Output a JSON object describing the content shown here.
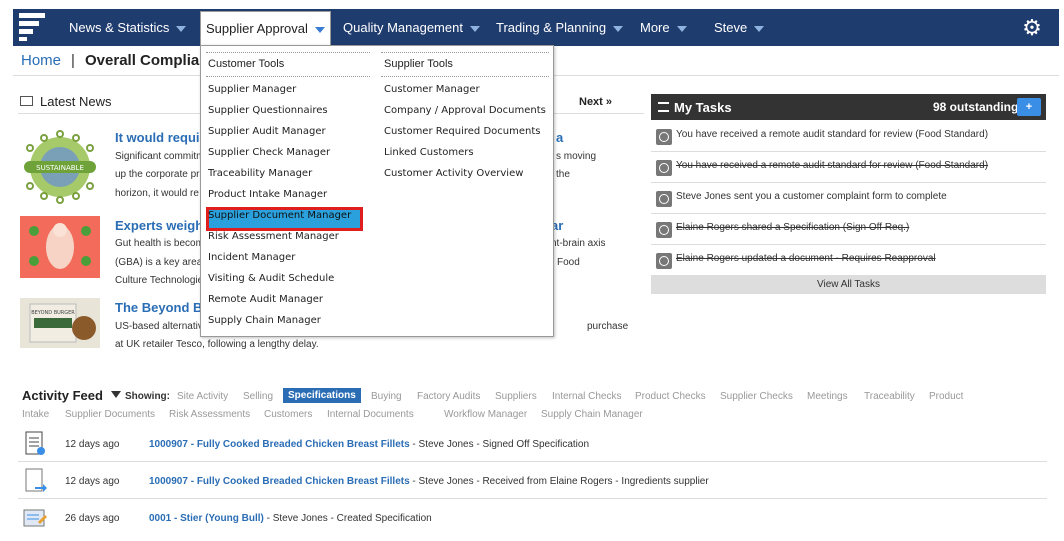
{
  "nav": {
    "items": [
      {
        "label": "News & Statistics"
      },
      {
        "label": "Supplier Approval"
      },
      {
        "label": "Quality Management"
      },
      {
        "label": "Trading & Planning"
      },
      {
        "label": "More"
      },
      {
        "label": "Steve"
      }
    ]
  },
  "breadcrumb": {
    "home": "Home",
    "separator": "|",
    "page": "Overall Complian"
  },
  "news": {
    "title": "Latest News",
    "next": "Next »",
    "items": [
      {
        "title": "It would require",
        "title_right": "a",
        "lines": [
          "Significant commitm",
          "up the corporate pri",
          "horizon, it would re"
        ],
        "lines_right": [
          "s moving",
          "the"
        ],
        "thumb_text": "SUSTAINABLE"
      },
      {
        "title": "Experts weigh",
        "title_right": "ar",
        "lines": [
          "Gut health is becom",
          "(GBA) is a key area",
          "Culture Technologie"
        ],
        "lines_right": [
          "nt-brain axis",
          "Food"
        ]
      },
      {
        "title": "The Beyond Bu",
        "lines": [
          "US-based alternativ",
          "at UK retailer Tesco, following a lengthy delay."
        ],
        "lines_right": [
          "purchase"
        ],
        "thumb_text": "BEYOND BURGER"
      }
    ]
  },
  "tasks": {
    "title": "My Tasks",
    "count": "98 outstanding",
    "plus": "+",
    "view_all": "View All Tasks",
    "items": [
      {
        "text": "You have received a remote audit standard for review (Food Standard)",
        "done": false
      },
      {
        "text": "You have received a remote audit standard for review (Food Standard)",
        "done": true
      },
      {
        "text": "Steve Jones sent you a customer complaint form to complete",
        "done": false
      },
      {
        "text": "Elaine Rogers shared a Specification (Sign Off Req.)",
        "done": true
      },
      {
        "text": "Elaine Rogers updated a document - Requires Reapproval",
        "done": true
      }
    ]
  },
  "dropdown": {
    "customer_tools": {
      "heading": "Customer Tools",
      "items": [
        "Supplier Manager",
        "Supplier Questionnaires",
        "Supplier Audit Manager",
        "Supplier Check Manager",
        "Traceability Manager",
        "Product Intake Manager",
        "Supplier Document Manager",
        "Risk Assessment Manager",
        "Incident Manager",
        "Visiting & Audit Schedule",
        "Remote Audit Manager",
        "Supply Chain Manager"
      ]
    },
    "supplier_tools": {
      "heading": "Supplier Tools",
      "items": [
        "Customer Manager",
        "Company / Approval Documents",
        "Customer Required Documents",
        "Linked Customers",
        "Customer Activity Overview"
      ]
    }
  },
  "activity": {
    "title": "Activity Feed",
    "showing": "Showing:",
    "filters_row1": [
      "Site Activity",
      "Selling",
      "Specifications",
      "Buying",
      "Factory Audits",
      "Suppliers",
      "Internal Checks",
      "Product Checks",
      "Supplier Checks",
      "Meetings",
      "Traceability",
      "Product"
    ],
    "filters_row2": [
      "Intake",
      "Supplier Documents",
      "Risk Assessments",
      "Customers",
      "Internal Documents",
      "Workflow Manager",
      "Supply Chain Manager"
    ],
    "selected": "Specifications",
    "rows": [
      {
        "ago": "12 days ago",
        "link": "1000907 - Fully Cooked Breaded Chicken Breast Fillets",
        "rest": " - Steve Jones - Signed Off Specification"
      },
      {
        "ago": "12 days ago",
        "link": "1000907 - Fully Cooked Breaded Chicken Breast Fillets",
        "rest": " - Steve Jones - Received from Elaine Rogers - Ingredients supplier"
      },
      {
        "ago": "26 days ago",
        "link": "0001 - Stier (Young Bull)",
        "rest": " - Steve Jones - Created Specification"
      }
    ]
  },
  "colors": {
    "nav_bg": "#1f3c6e",
    "link": "#2a6db5",
    "highlight": "#2aa0dc",
    "highlight_border": "#e01e1e"
  },
  "icons": {
    "logo": "logo-icon",
    "gear": "gear-icon",
    "filter": "filter-icon",
    "tasks": "list-icon",
    "clock": "clock-icon"
  }
}
